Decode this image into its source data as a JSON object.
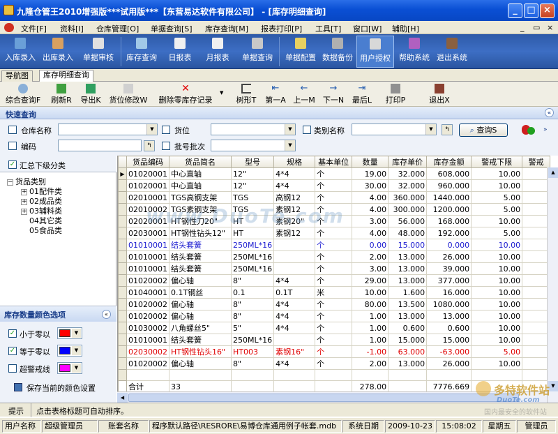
{
  "title": "九隆仓管王2010增强版***试用版***【东营易达软件有限公司】 - [库存明细查询]",
  "window_controls": {
    "minimize": "_",
    "maximize": "□",
    "close": "×"
  },
  "menu": [
    "文件[F]",
    "资料[I]",
    "仓库管理[O]",
    "单据查询[S]",
    "库存查询[M]",
    "报表打印[P]",
    "工具[T]",
    "窗口[W]",
    "辅助[H]"
  ],
  "menu_right": {
    "min": "_",
    "restore": "▭",
    "close": "×"
  },
  "toolbar1": [
    "入库录入",
    "出库录入",
    "单据审核",
    "库存查询",
    "日报表",
    "月报表",
    "单据查询",
    "单据配置",
    "数据备份",
    "用户授权",
    "帮助系统",
    "退出系统"
  ],
  "tabs": [
    "导航图",
    "库存明细查询"
  ],
  "toolbar2": [
    "综合查询F",
    "刷新R",
    "导出K",
    "货位修改W",
    "删除零库存记录",
    "树形T",
    "第一A",
    "上一M",
    "下一N",
    "最后L",
    "打印P",
    "退出X"
  ],
  "quick_search": {
    "label": "快速查询",
    "collapse": "«"
  },
  "filters": {
    "warehouse": "仓库名称",
    "location": "货位",
    "category": "类别名称",
    "code": "编码",
    "batch": "批号批次",
    "query_button": "查询S"
  },
  "left": {
    "summary_label": "汇总下级分类",
    "tree_root": "货品类别",
    "tree_items": [
      "01配件类",
      "02成品类",
      "03辅料类",
      "04其它类",
      "05食品类"
    ],
    "color_header": "库存数量颜色选项",
    "color_options": [
      {
        "label": "小于零以",
        "checked": true,
        "color": "#ff0000"
      },
      {
        "label": "等于零以",
        "checked": true,
        "color": "#0000ff"
      },
      {
        "label": "超警戒线",
        "checked": false,
        "color": "#ff00ff"
      }
    ],
    "save_colors": "保存当前的颜色设置"
  },
  "table": {
    "columns": [
      "货品编码",
      "货品简名",
      "型号",
      "规格",
      "基本单位",
      "数量",
      "库存单价",
      "库存金额",
      "警戒下限",
      "警戒"
    ],
    "rows": [
      [
        "01020001",
        "中心直轴",
        "12\"",
        "4*4",
        "个",
        "19.00",
        "32.000",
        "608.000",
        "10.00",
        "",
        ""
      ],
      [
        "01020001",
        "中心直轴",
        "12\"",
        "4*4",
        "个",
        "30.00",
        "32.000",
        "960.000",
        "10.00",
        "",
        ""
      ],
      [
        "02010001",
        "TGS高钢支架",
        "TGS",
        "高钢12",
        "个",
        "4.00",
        "360.000",
        "1440.000",
        "5.00",
        "",
        ""
      ],
      [
        "02010002",
        "TGS素钢支架",
        "TGS",
        "素钢12",
        "个",
        "4.00",
        "300.000",
        "1200.000",
        "5.00",
        "",
        ""
      ],
      [
        "02020001",
        "HT钢性刀20\"",
        "HT",
        "素钢20\"",
        "个",
        "3.00",
        "56.000",
        "168.000",
        "10.00",
        "",
        ""
      ],
      [
        "02030001",
        "HT钢性钻头12\"",
        "HT",
        "素钢12",
        "个",
        "4.00",
        "48.000",
        "192.000",
        "5.00",
        "",
        ""
      ],
      [
        "01010001",
        "结头套簧",
        "250ML*16",
        "",
        "个",
        "0.00",
        "15.000",
        "0.000",
        "10.00",
        "",
        "blue"
      ],
      [
        "01010001",
        "结头套簧",
        "250ML*16",
        "",
        "个",
        "2.00",
        "13.000",
        "26.000",
        "10.00",
        "",
        ""
      ],
      [
        "01010001",
        "结头套簧",
        "250ML*16",
        "",
        "个",
        "3.00",
        "13.000",
        "39.000",
        "10.00",
        "",
        ""
      ],
      [
        "01020002",
        "偏心轴",
        "8\"",
        "4*4",
        "个",
        "29.00",
        "13.000",
        "377.000",
        "10.00",
        "",
        ""
      ],
      [
        "01040001",
        "0.1T钢丝",
        "0.1",
        "0.1T",
        "米",
        "10.00",
        "1.600",
        "16.000",
        "10.00",
        "",
        ""
      ],
      [
        "01020002",
        "偏心轴",
        "8\"",
        "4*4",
        "个",
        "80.00",
        "13.500",
        "1080.000",
        "10.00",
        "",
        ""
      ],
      [
        "01020002",
        "偏心轴",
        "8\"",
        "4*4",
        "个",
        "1.00",
        "13.000",
        "13.000",
        "10.00",
        "",
        ""
      ],
      [
        "01030002",
        "八角螺丝5\"",
        "5\"",
        "4*4",
        "个",
        "1.00",
        "0.600",
        "0.600",
        "10.00",
        "",
        ""
      ],
      [
        "01010001",
        "结头套簧",
        "250ML*16",
        "",
        "个",
        "1.00",
        "15.000",
        "15.000",
        "10.00",
        "",
        ""
      ],
      [
        "02030002",
        "HT钢性钻头16\"",
        "HT003",
        "素钢16\"",
        "个",
        "-1.00",
        "63.000",
        "-63.000",
        "5.00",
        "",
        "red"
      ],
      [
        "01020002",
        "偏心轴",
        "8\"",
        "4*4",
        "个",
        "2.00",
        "13.000",
        "26.000",
        "10.00",
        "",
        ""
      ]
    ],
    "total_label": "合计",
    "total_count": "33",
    "total_qty": "278.00",
    "total_amount": "7776.669"
  },
  "watermark": "www.DuoTe.com",
  "hint": {
    "label": "提示",
    "text": "点击表格标题可自动排序。"
  },
  "status": {
    "user_label": "用户名称",
    "user": "超级管理员",
    "account_label": "账套名称",
    "path": "程序默认路径\\RESRORE\\易博仓库通用例子帐套.mdb",
    "date_label": "系统日期",
    "date": "2009-10-23",
    "time": "15:08:02",
    "weekday": "星期五",
    "role": "管理员"
  },
  "logo": {
    "brand": "多特软件站",
    "sub": "DuoTe.com",
    "slogan": "国内最安全的软件站"
  }
}
